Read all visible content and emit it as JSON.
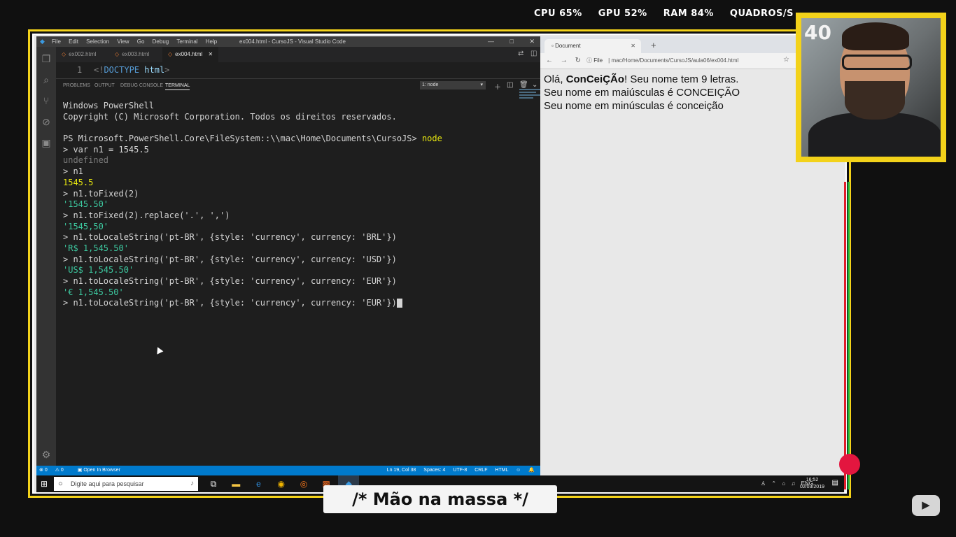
{
  "overlay": {
    "stats": [
      "CPU 65%",
      "GPU 52%",
      "RAM 84%",
      "QUADROS/S"
    ],
    "caption": "/* Mão na massa */",
    "webcam_text": "40"
  },
  "vscode": {
    "menu": [
      "File",
      "Edit",
      "Selection",
      "View",
      "Go",
      "Debug",
      "Terminal",
      "Help"
    ],
    "window_title": "ex004.html - CursoJS - Visual Studio Code",
    "tabs": [
      "ex002.html",
      "ex003.html",
      "ex004.html"
    ],
    "active_tab": "ex004.html",
    "editor": {
      "line_number": "1",
      "doctype_open": "<!",
      "doctype_keyword": "DOCTYPE",
      "doctype_value": "html",
      "doctype_close": ">"
    },
    "panel_tabs": [
      "PROBLEMS",
      "OUTPUT",
      "DEBUG CONSOLE",
      "TERMINAL"
    ],
    "active_panel": "TERMINAL",
    "terminal_select": "1: node",
    "terminal_lines": [
      {
        "text": "Windows PowerShell",
        "style": "normal"
      },
      {
        "text": "Copyright (C) Microsoft Corporation. Todos os direitos reservados.",
        "style": "normal"
      },
      {
        "text": "",
        "style": "blank"
      },
      {
        "text": "PS Microsoft.PowerShell.Core\\FileSystem::\\\\mac\\Home\\Documents\\CursoJS> ",
        "style": "normal",
        "suffix": "node"
      },
      {
        "text": "> var n1 = 1545.5",
        "style": "normal"
      },
      {
        "text": "undefined",
        "style": "gray"
      },
      {
        "text": "> n1",
        "style": "normal"
      },
      {
        "text": "1545.5",
        "style": "yellow"
      },
      {
        "text": "> n1.toFixed(2)",
        "style": "normal"
      },
      {
        "text": "'1545.50'",
        "style": "green"
      },
      {
        "text": "> n1.toFixed(2).replace('.', ',')",
        "style": "normal"
      },
      {
        "text": "'1545,50'",
        "style": "green"
      },
      {
        "text": "> n1.toLocaleString('pt-BR', {style: 'currency', currency: 'BRL'})",
        "style": "normal"
      },
      {
        "text": "'R$ 1,545.50'",
        "style": "green"
      },
      {
        "text": "> n1.toLocaleString('pt-BR', {style: 'currency', currency: 'USD'})",
        "style": "normal"
      },
      {
        "text": "'US$ 1,545.50'",
        "style": "green"
      },
      {
        "text": "> n1.toLocaleString('pt-BR', {style: 'currency', currency: 'EUR'})",
        "style": "normal"
      },
      {
        "text": "'€ 1,545.50'",
        "style": "green"
      },
      {
        "text": "> n1.toLocaleString('pt-BR', {style: 'currency', currency: 'EUR'})",
        "style": "normal",
        "cursor": true
      }
    ],
    "statusbar": {
      "left": [
        "0",
        "0",
        "Open In Browser"
      ],
      "right": [
        "Ln 19, Col 38",
        "Spaces: 4",
        "UTF-8",
        "CRLF",
        "HTML"
      ]
    }
  },
  "browser": {
    "tab_title": "Document",
    "url_label": "File",
    "url": "mac/Home/Documents/CursoJS/aula06/ex004.html",
    "page": {
      "line1_prefix": "Olá, ",
      "line1_name": "ConCeiÇÃo",
      "line1_suffix": "! Seu nome tem 9 letras.",
      "line2": "Seu nome em maiúsculas é CONCEIÇÃO",
      "line3": "Seu nome em minúsculas é conceição"
    }
  },
  "taskbar": {
    "search_placeholder": "Digite aqui para pesquisar",
    "language": "ENG",
    "time": "16:52",
    "date": "02/03/2019"
  },
  "colors": {
    "frame_yellow": "#f3d21a",
    "vscode_status": "#007acc",
    "terminal_green": "#3dc9a0",
    "terminal_yellow": "#e5e510",
    "record_dot": "#e3163f"
  }
}
